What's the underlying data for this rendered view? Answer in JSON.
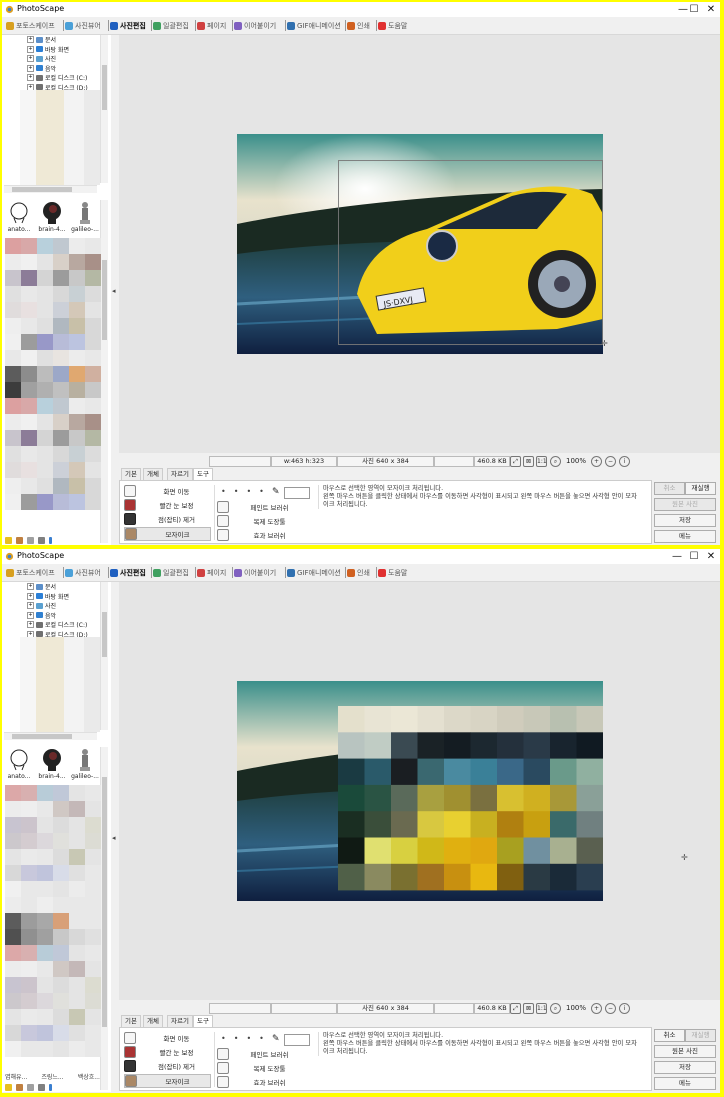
{
  "app": {
    "title": "PhotoScape"
  },
  "window_buttons": {
    "minimize": "—",
    "maximize": "☐",
    "close": "✕"
  },
  "menu_tabs": [
    {
      "label": "포토스케이프",
      "color": "#d8a020"
    },
    {
      "label": "사진뷰어",
      "color": "#4aa0d8"
    },
    {
      "label": "사진편집",
      "color": "#2060c0"
    },
    {
      "label": "일괄편집",
      "color": "#40a060"
    },
    {
      "label": "페이지",
      "color": "#d04040"
    },
    {
      "label": "이어붙이기",
      "color": "#8060c0"
    },
    {
      "label": "GIF애니메이션",
      "color": "#3070b0"
    },
    {
      "label": "인쇄",
      "color": "#d06020"
    },
    {
      "label": "도움말",
      "color": "#e03030"
    }
  ],
  "tree_items": [
    {
      "label": "문서",
      "color": "#5c8fc9"
    },
    {
      "label": "바탕 화면",
      "color": "#2b7fd6"
    },
    {
      "label": "사진",
      "color": "#5aa0d0"
    },
    {
      "label": "음악",
      "color": "#3080d0"
    },
    {
      "label": "로컬 디스크 (C:)",
      "color": "#707070"
    },
    {
      "label": "로컬 디스크 (D:)",
      "color": "#707070"
    }
  ],
  "thumbnails": [
    {
      "caption": "anato...",
      "icon": "anatomy-sketch"
    },
    {
      "caption": "brain-4...",
      "icon": "brain-silhouette"
    },
    {
      "caption": "galileo-...",
      "icon": "statue"
    }
  ],
  "thumbnail_captions_bottom": [
    "엽해유...",
    "즈링느...",
    "백상흐..."
  ],
  "status": {
    "size_info": "w:463 h:323",
    "photo_size": "사진 640 x 384",
    "file_size": "460.8 KB",
    "zoom": "100%"
  },
  "bottom_tabs": [
    "기본",
    "개체",
    "자르기",
    "도구"
  ],
  "tools": {
    "move": "화면 이동",
    "red_eye": "빨간 눈 보정",
    "mole": "점(잡티) 제거",
    "mosaic": "모자이크",
    "paint": "페인트 브러쉬",
    "clone": "복제 도장툴",
    "effect": "효과 브러쉬"
  },
  "description": [
    "마우스로 선택한 영역이 모자이크 처리됩니다.",
    "왼쪽 마우스 버튼을 클릭한 상태에서 마우스를 이동하면 사각형이 표시되고 왼쪽 마우스 버튼을 놓으면 사각형 안이 모자",
    "이크 처리됩니다."
  ],
  "right_buttons": {
    "cancel": "취소",
    "redo": "재실행",
    "original": "원본 사진",
    "save": "저장",
    "menu": "메뉴"
  }
}
